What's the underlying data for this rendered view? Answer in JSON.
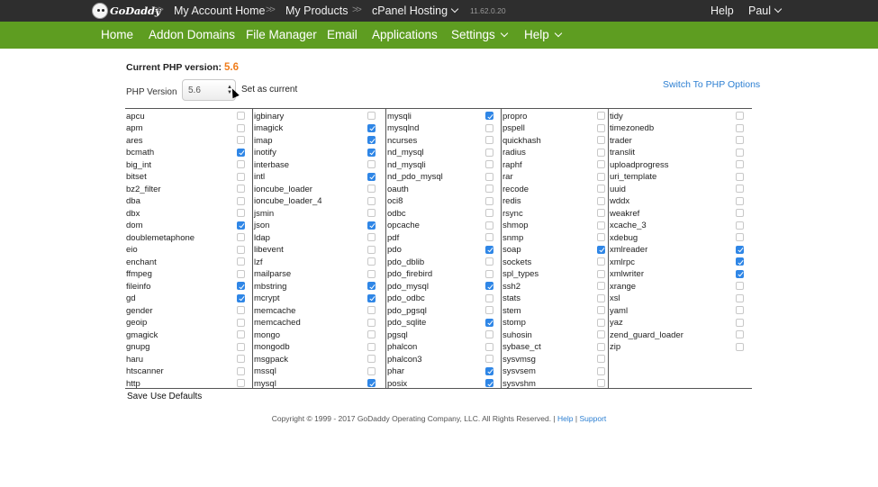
{
  "topbar": {
    "logo": "GoDaddy",
    "breadcrumbs": [
      "My Account Home",
      "My Products",
      "cPanel Hosting"
    ],
    "version": "11.62.0.20",
    "help": "Help",
    "user": "Paul"
  },
  "nav": {
    "items": [
      "Home",
      "Addon Domains",
      "File Manager",
      "Email",
      "Applications",
      "Settings",
      "Help"
    ]
  },
  "php": {
    "current_label": "Current PHP version:",
    "current_value": "5.6",
    "version_label": "PHP Version",
    "selected": "5.6",
    "set_current": "Set as current",
    "switch_link": "Switch To PHP Options"
  },
  "extensions": [
    [
      {
        "name": "apcu",
        "checked": false
      },
      {
        "name": "apm",
        "checked": false
      },
      {
        "name": "ares",
        "checked": false
      },
      {
        "name": "bcmath",
        "checked": true
      },
      {
        "name": "big_int",
        "checked": false
      },
      {
        "name": "bitset",
        "checked": false
      },
      {
        "name": "bz2_filter",
        "checked": false
      },
      {
        "name": "dba",
        "checked": false
      },
      {
        "name": "dbx",
        "checked": false
      },
      {
        "name": "dom",
        "checked": true
      },
      {
        "name": "doublemetaphone",
        "checked": false
      },
      {
        "name": "eio",
        "checked": false
      },
      {
        "name": "enchant",
        "checked": false
      },
      {
        "name": "ffmpeg",
        "checked": false
      },
      {
        "name": "fileinfo",
        "checked": true
      },
      {
        "name": "gd",
        "checked": true
      },
      {
        "name": "gender",
        "checked": false
      },
      {
        "name": "geoip",
        "checked": false
      },
      {
        "name": "gmagick",
        "checked": false
      },
      {
        "name": "gnupg",
        "checked": false
      },
      {
        "name": "haru",
        "checked": false
      },
      {
        "name": "htscanner",
        "checked": false
      },
      {
        "name": "http",
        "checked": false
      }
    ],
    [
      {
        "name": "igbinary",
        "checked": false
      },
      {
        "name": "imagick",
        "checked": true
      },
      {
        "name": "imap",
        "checked": true
      },
      {
        "name": "inotify",
        "checked": true
      },
      {
        "name": "interbase",
        "checked": false
      },
      {
        "name": "intl",
        "checked": true
      },
      {
        "name": "ioncube_loader",
        "checked": false
      },
      {
        "name": "ioncube_loader_4",
        "checked": false
      },
      {
        "name": "jsmin",
        "checked": false
      },
      {
        "name": "json",
        "checked": true
      },
      {
        "name": "ldap",
        "checked": false
      },
      {
        "name": "libevent",
        "checked": false
      },
      {
        "name": "lzf",
        "checked": false
      },
      {
        "name": "mailparse",
        "checked": false
      },
      {
        "name": "mbstring",
        "checked": true
      },
      {
        "name": "mcrypt",
        "checked": true
      },
      {
        "name": "memcache",
        "checked": false
      },
      {
        "name": "memcached",
        "checked": false
      },
      {
        "name": "mongo",
        "checked": false
      },
      {
        "name": "mongodb",
        "checked": false
      },
      {
        "name": "msgpack",
        "checked": false
      },
      {
        "name": "mssql",
        "checked": false
      },
      {
        "name": "mysql",
        "checked": true
      }
    ],
    [
      {
        "name": "mysqli",
        "checked": true
      },
      {
        "name": "mysqlnd",
        "checked": false
      },
      {
        "name": "ncurses",
        "checked": false
      },
      {
        "name": "nd_mysql",
        "checked": false
      },
      {
        "name": "nd_mysqli",
        "checked": false
      },
      {
        "name": "nd_pdo_mysql",
        "checked": false
      },
      {
        "name": "oauth",
        "checked": false
      },
      {
        "name": "oci8",
        "checked": false
      },
      {
        "name": "odbc",
        "checked": false
      },
      {
        "name": "opcache",
        "checked": false
      },
      {
        "name": "pdf",
        "checked": false
      },
      {
        "name": "pdo",
        "checked": true
      },
      {
        "name": "pdo_dblib",
        "checked": false
      },
      {
        "name": "pdo_firebird",
        "checked": false
      },
      {
        "name": "pdo_mysql",
        "checked": true
      },
      {
        "name": "pdo_odbc",
        "checked": false
      },
      {
        "name": "pdo_pgsql",
        "checked": false
      },
      {
        "name": "pdo_sqlite",
        "checked": true
      },
      {
        "name": "pgsql",
        "checked": false
      },
      {
        "name": "phalcon",
        "checked": false
      },
      {
        "name": "phalcon3",
        "checked": false
      },
      {
        "name": "phar",
        "checked": true
      },
      {
        "name": "posix",
        "checked": true
      }
    ],
    [
      {
        "name": "propro",
        "checked": false
      },
      {
        "name": "pspell",
        "checked": false
      },
      {
        "name": "quickhash",
        "checked": false
      },
      {
        "name": "radius",
        "checked": false
      },
      {
        "name": "raphf",
        "checked": false
      },
      {
        "name": "rar",
        "checked": false
      },
      {
        "name": "recode",
        "checked": false
      },
      {
        "name": "redis",
        "checked": false
      },
      {
        "name": "rsync",
        "checked": false
      },
      {
        "name": "shmop",
        "checked": false
      },
      {
        "name": "snmp",
        "checked": false
      },
      {
        "name": "soap",
        "checked": true
      },
      {
        "name": "sockets",
        "checked": false
      },
      {
        "name": "spl_types",
        "checked": false
      },
      {
        "name": "ssh2",
        "checked": false
      },
      {
        "name": "stats",
        "checked": false
      },
      {
        "name": "stem",
        "checked": false
      },
      {
        "name": "stomp",
        "checked": false
      },
      {
        "name": "suhosin",
        "checked": false
      },
      {
        "name": "sybase_ct",
        "checked": false
      },
      {
        "name": "sysvmsg",
        "checked": false
      },
      {
        "name": "sysvsem",
        "checked": false
      },
      {
        "name": "sysvshm",
        "checked": false
      }
    ],
    [
      {
        "name": "tidy",
        "checked": false
      },
      {
        "name": "timezonedb",
        "checked": false
      },
      {
        "name": "trader",
        "checked": false
      },
      {
        "name": "translit",
        "checked": false
      },
      {
        "name": "uploadprogress",
        "checked": false
      },
      {
        "name": "uri_template",
        "checked": false
      },
      {
        "name": "uuid",
        "checked": false
      },
      {
        "name": "wddx",
        "checked": false
      },
      {
        "name": "weakref",
        "checked": false
      },
      {
        "name": "xcache_3",
        "checked": false
      },
      {
        "name": "xdebug",
        "checked": false
      },
      {
        "name": "xmlreader",
        "checked": true
      },
      {
        "name": "xmlrpc",
        "checked": true
      },
      {
        "name": "xmlwriter",
        "checked": true
      },
      {
        "name": "xrange",
        "checked": false
      },
      {
        "name": "xsl",
        "checked": false
      },
      {
        "name": "yaml",
        "checked": false
      },
      {
        "name": "yaz",
        "checked": false
      },
      {
        "name": "zend_guard_loader",
        "checked": false
      },
      {
        "name": "zip",
        "checked": false
      }
    ]
  ],
  "actions": {
    "save": "Save",
    "defaults": "Use Defaults"
  },
  "footer": {
    "text": "Copyright © 1999 - 2017 GoDaddy Operating Company, LLC. All Rights Reserved. |",
    "help": "Help",
    "pipe": "|",
    "support": "Support"
  },
  "colors": {
    "nav_bg": "#5e9d21",
    "topbar_bg": "#2e2e2e",
    "accent_orange": "#f07c1a",
    "link_blue": "#2c7fd2",
    "checkbox_blue": "#2f86e6"
  }
}
